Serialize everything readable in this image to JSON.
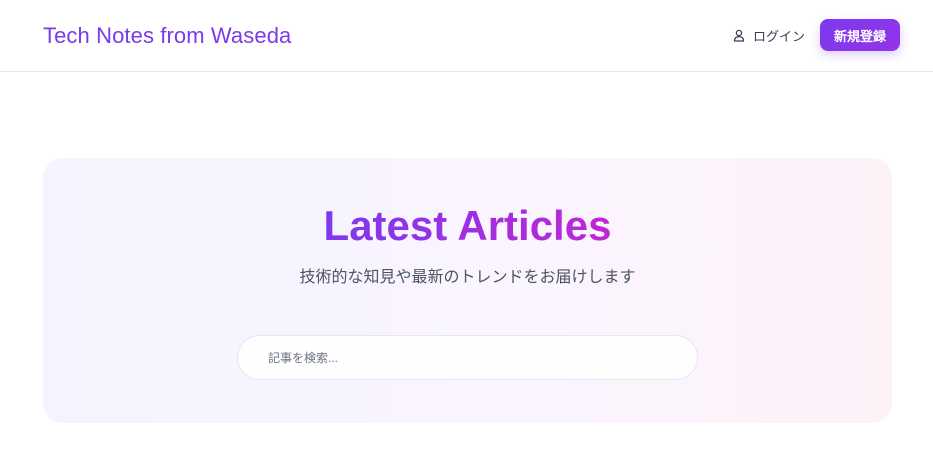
{
  "header": {
    "brand": "Tech Notes from Waseda",
    "login_label": "ログイン",
    "login_icon": "user-icon",
    "signup_label": "新規登録"
  },
  "hero": {
    "title": "Latest Articles",
    "subtitle": "技術的な知見や最新のトレンドをお届けします",
    "search_placeholder": "記事を検索..."
  },
  "colors": {
    "accent": "#7c3aed",
    "accent_end": "#c026d3",
    "hero_bg_start": "#f5f3ff",
    "hero_bg_end": "#fdf2f8"
  }
}
